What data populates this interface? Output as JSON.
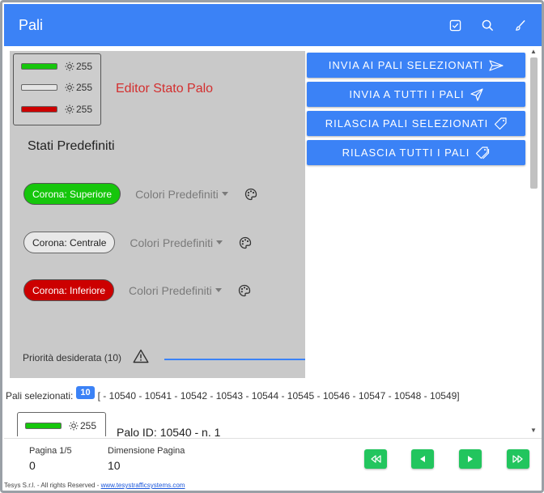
{
  "appbar": {
    "title": "Pali",
    "icons": [
      "check-square-icon",
      "search-icon",
      "brush-icon"
    ]
  },
  "editor": {
    "status": [
      {
        "color": "#16c60c",
        "value": "255"
      },
      {
        "color": "#e5e5e5",
        "value": "255"
      },
      {
        "color": "#cc0000",
        "value": "255"
      }
    ],
    "title": "Editor Stato Palo",
    "presets_title": "Stati Predefiniti",
    "presets": [
      {
        "label": "Corona: Superiore",
        "bg": "#16c60c",
        "fg": "#ffffff",
        "dropdown": "Colori Predefiniti"
      },
      {
        "label": "Corona: Centrale",
        "bg": "#e8e8e8",
        "fg": "#222222",
        "dropdown": "Colori Predefiniti"
      },
      {
        "label": "Corona: Inferiore",
        "bg": "#cc0000",
        "fg": "#ffffff",
        "dropdown": "Colori Predefiniti"
      }
    ],
    "priority_label": "Priorità desiderata (10)"
  },
  "actions": [
    {
      "label": "INVIA AI PALI SELEZIONATI",
      "icon": "send-icon"
    },
    {
      "label": "INVIA A TUTTI I PALI",
      "icon": "paper-plane-icon"
    },
    {
      "label": "RILASCIA PALI SELEZIONATI",
      "icon": "tag-icon"
    },
    {
      "label": "RILASCIA TUTTI I PALI",
      "icon": "tags-icon"
    }
  ],
  "selection": {
    "label": "Pali selezionati:",
    "count": "10",
    "list": "[ - 10540 - 10541 - 10542 - 10543 - 10544 - 10545 - 10546 - 10547 - 10548 - 10549]"
  },
  "pole": {
    "bar_color": "#16c60c",
    "value": "255",
    "id_label": "Palo ID: 10540 - n. 1"
  },
  "footer": {
    "page_label": "Pagina 1/5",
    "page_value": "0",
    "size_label": "Dimensione Pagina",
    "size_value": "10",
    "nav": [
      "first-page-icon",
      "prev-page-icon",
      "next-page-icon",
      "last-page-icon"
    ],
    "nav_color": "#22c55e"
  },
  "copyright": {
    "text": "Tesys S.r.l. - All rights Reserved - ",
    "link": "www.tesystrafficsystems.com"
  }
}
